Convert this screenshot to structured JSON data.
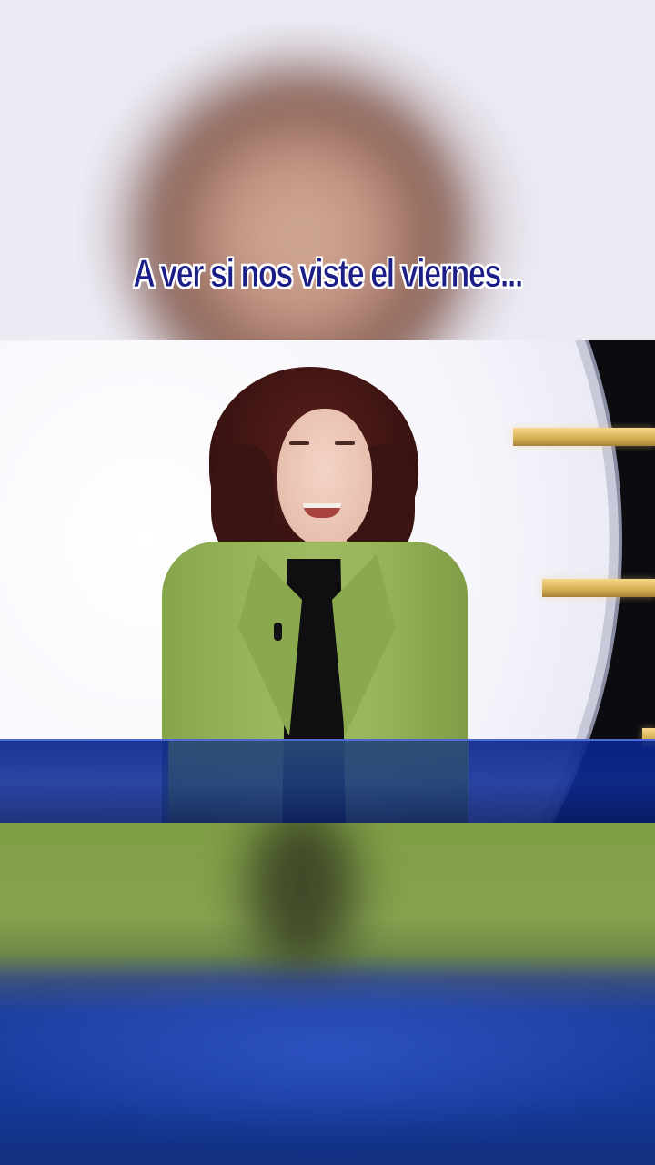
{
  "video": {
    "caption": "A ver si nos viste el viernes..."
  },
  "colors": {
    "caption_text": "#1b1e86",
    "caption_outline": "#ffffff",
    "blazer": "#98b55b",
    "desk": "#0e2c96",
    "set_lights": "#d4ad52"
  }
}
